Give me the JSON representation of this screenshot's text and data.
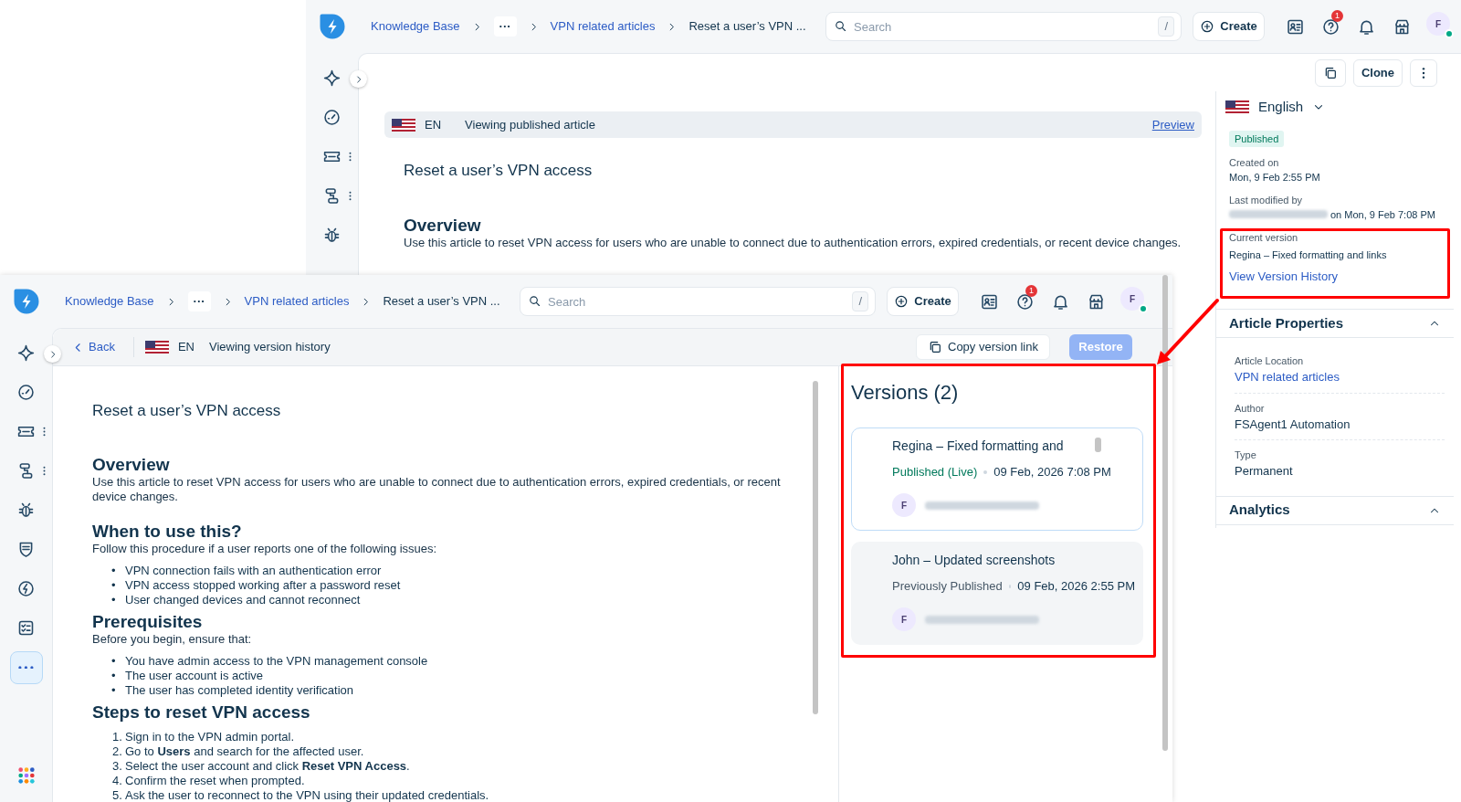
{
  "back_window": {
    "top_bar": {
      "breadcrumbs": [
        {
          "kind": "link",
          "label": "Knowledge Base"
        },
        {
          "kind": "more",
          "label": "···"
        },
        {
          "kind": "link",
          "label": "VPN related articles"
        },
        {
          "kind": "current",
          "label": "Reset a user’s VPN ..."
        }
      ],
      "search_placeholder": "Search",
      "search_shortcut": "/",
      "create_button": "Create",
      "help_count": "1",
      "avatar": "F"
    },
    "sidebar": {
      "items": [
        {
          "kind": "sparkle",
          "menu": false,
          "selected": false
        },
        {
          "kind": "gauge",
          "menu": false,
          "selected": false
        },
        {
          "kind": "ticket",
          "menu": true,
          "selected": false
        },
        {
          "kind": "flow",
          "menu": true,
          "selected": false
        },
        {
          "kind": "bug",
          "menu": false,
          "selected": false
        }
      ]
    },
    "toolbar": {
      "clone_button": "Clone"
    },
    "banner": {
      "language": "EN",
      "status": "Viewing published article",
      "action": "Preview"
    },
    "article": {
      "title": "Reset a user’s VPN access",
      "blocks": [
        {
          "kind": "heading",
          "text": "Overview"
        },
        {
          "kind": "paragraph",
          "text": "Use this article to reset VPN access for users who are unable to connect due to authentication errors, expired credentials, or recent device changes."
        }
      ]
    },
    "details": {
      "language": "English",
      "status_badge": "Published",
      "created_label": "Created on",
      "created_value": "Mon, 9 Feb 2:55 PM",
      "modified_label": "Last modified by",
      "modifier_blurred": true,
      "modified_value": "on Mon, 9 Feb 7:08 PM",
      "current_version_label": "Current version",
      "current_version_value": "Regina – Fixed formatting and links",
      "history_link": "View Version History"
    },
    "sections": [
      {
        "title": "Article Properties",
        "expanded": true,
        "fields": [
          {
            "label": "Article Location",
            "value": "VPN related articles",
            "kind": "link"
          },
          {
            "label": "Author",
            "value": "FSAgent1 Automation",
            "kind": "text"
          },
          {
            "label": "Type",
            "value": "Permanent",
            "kind": "text"
          }
        ]
      },
      {
        "title": "Analytics",
        "expanded": true
      }
    ]
  },
  "front_window": {
    "top_bar": {
      "breadcrumbs": [
        {
          "kind": "link",
          "label": "Knowledge Base"
        },
        {
          "kind": "more",
          "label": "···"
        },
        {
          "kind": "link",
          "label": "VPN related articles"
        },
        {
          "kind": "current",
          "label": "Reset a user’s VPN ..."
        }
      ],
      "search_placeholder": "Search",
      "search_shortcut": "/",
      "create_button": "Create",
      "help_count": "1",
      "avatar": "F"
    },
    "sidebar": {
      "apps_launcher": true,
      "items": [
        {
          "kind": "sparkle",
          "menu": false,
          "selected": false
        },
        {
          "kind": "gauge",
          "menu": false,
          "selected": false
        },
        {
          "kind": "ticket",
          "menu": true,
          "selected": false
        },
        {
          "kind": "flow",
          "menu": true,
          "selected": false
        },
        {
          "kind": "bug",
          "menu": false,
          "selected": false
        },
        {
          "kind": "shield",
          "menu": false,
          "selected": false
        },
        {
          "kind": "bolt",
          "menu": false,
          "selected": false
        },
        {
          "kind": "checklist",
          "menu": false,
          "selected": false
        },
        {
          "kind": "more",
          "menu": false,
          "selected": true
        }
      ]
    },
    "toolbar": {
      "back_link": "Back",
      "language": "EN",
      "status": "Viewing version history",
      "copy_button": "Copy version link",
      "restore_button": {
        "label": "Restore",
        "disabled": true
      }
    },
    "article": {
      "title": "Reset a user’s VPN access",
      "blocks": [
        {
          "kind": "heading",
          "text": "Overview"
        },
        {
          "kind": "paragraph",
          "text": "Use this article to reset VPN access for users who are unable to connect due to authentication errors, expired credentials, or recent device changes."
        },
        {
          "kind": "heading",
          "text": "When to use this?"
        },
        {
          "kind": "paragraph",
          "text": "Follow this procedure if a user reports one of the following issues:"
        },
        {
          "kind": "bullets",
          "items": [
            {
              "marker": "•",
              "text": "VPN connection fails with an authentication error"
            },
            {
              "marker": "•",
              "text": "VPN access stopped working after a password reset"
            },
            {
              "marker": "•",
              "text": "User changed devices and cannot reconnect"
            }
          ]
        },
        {
          "kind": "heading",
          "text": "Prerequisites"
        },
        {
          "kind": "paragraph",
          "text": "Before you begin, ensure that:"
        },
        {
          "kind": "bullets",
          "items": [
            {
              "marker": "•",
              "text": "You have admin access to the VPN management console"
            },
            {
              "marker": "•",
              "text": "The user account is active"
            },
            {
              "marker": "•",
              "text": "The user has completed identity verification"
            }
          ]
        },
        {
          "kind": "heading",
          "text": "Steps to reset VPN access"
        },
        {
          "kind": "numbered",
          "items": [
            {
              "marker": "1.",
              "text": "Sign in to the VPN admin portal."
            },
            {
              "marker": "2.",
              "text": "Go to **Users** and search for the affected user."
            },
            {
              "marker": "3.",
              "text": "Select the user account and click **Reset VPN Access**."
            },
            {
              "marker": "4.",
              "text": "Confirm the reset when prompted."
            },
            {
              "marker": "5.",
              "text": "Ask the user to reconnect to the VPN using their updated credentials."
            }
          ]
        }
      ]
    },
    "versions": {
      "title": "Versions (2)",
      "items": [
        {
          "title": "Regina – Fixed formatting and",
          "status": "Published (Live)",
          "color": "#00795b",
          "date": "09 Feb, 2026 7:08 PM",
          "avatar": "F",
          "author_blurred": true,
          "selected": true
        },
        {
          "title": "John – Updated screenshots",
          "status": "Previously Published",
          "color": "#475867",
          "date": "09 Feb, 2026 2:55 PM",
          "avatar": "F",
          "author_blurred": true,
          "selected": false
        }
      ]
    }
  }
}
